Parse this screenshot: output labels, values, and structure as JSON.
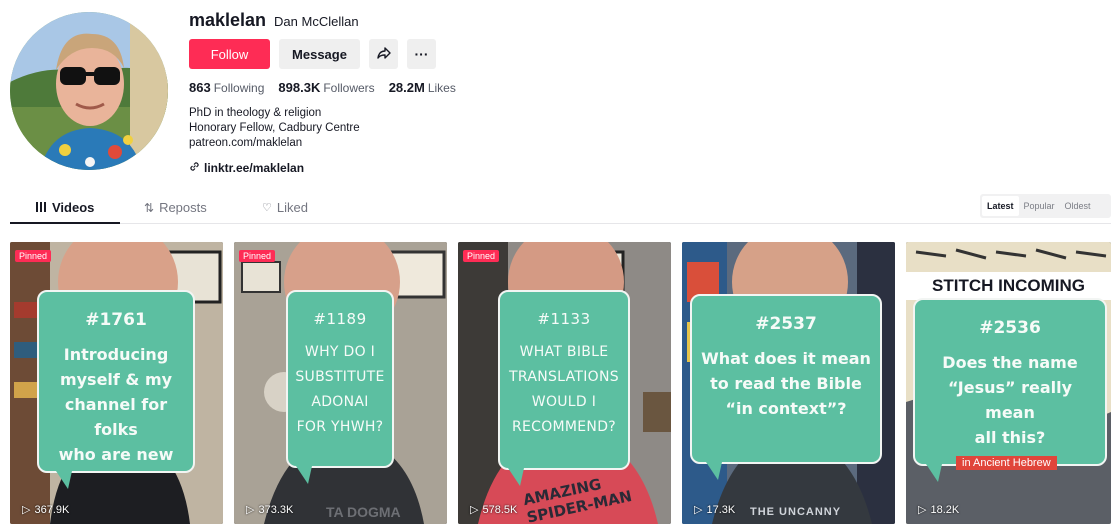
{
  "profile": {
    "username": "maklelan",
    "display_name": "Dan McClellan",
    "follow_label": "Follow",
    "message_label": "Message",
    "share_icon": "share-arrow-icon",
    "more_label": "···",
    "stats": [
      {
        "value": "863",
        "label": "Following"
      },
      {
        "value": "898.3K",
        "label": "Followers"
      },
      {
        "value": "28.2M",
        "label": "Likes"
      }
    ],
    "bio": [
      "PhD in theology & religion",
      "Honorary Fellow, Cadbury Centre",
      "patreon.com/maklelan"
    ],
    "link": "linktr.ee/maklelan"
  },
  "tabs": [
    {
      "label": "Videos",
      "icon": "grid-icon"
    },
    {
      "label": "Reposts",
      "icon": "repost-icon"
    },
    {
      "label": "Liked",
      "icon": "heart-icon"
    }
  ],
  "sort": [
    "Latest",
    "Popular",
    "Oldest"
  ],
  "videos": [
    {
      "pinned": "Pinned",
      "tag": "#1761",
      "lines": [
        "Introducing",
        "myself & my",
        "channel for folks",
        "who are new"
      ],
      "views": "367.9K"
    },
    {
      "pinned": "Pinned",
      "tag": "#1189",
      "lines": [
        "WHY DO I",
        "SUBSTITUTE",
        "ADONAI",
        "FOR YHWH?"
      ],
      "views": "373.3K",
      "bottom_text": "TA DOGMA"
    },
    {
      "pinned": "Pinned",
      "tag": "#1133",
      "lines": [
        "WHAT BIBLE",
        "TRANSLATIONS",
        "WOULD I",
        "RECOMMEND?"
      ],
      "views": "578.5K",
      "shirt_text": [
        "AMAZING",
        "SPIDER-MAN"
      ]
    },
    {
      "tag": "#2537",
      "lines": [
        "What does it mean",
        "to read the Bible",
        "“in context”?"
      ],
      "views": "17.3K",
      "shirt_text": [
        "THE UNCANNY"
      ]
    },
    {
      "header": "STITCH INCOMING",
      "tag": "#2536",
      "lines": [
        "Does the name",
        "“Jesus” really mean",
        "all this?"
      ],
      "views": "18.2K",
      "caption": "in Ancient Hebrew"
    }
  ],
  "colors": {
    "accent": "#fe2c55",
    "bubble": "#5cbfa1"
  }
}
